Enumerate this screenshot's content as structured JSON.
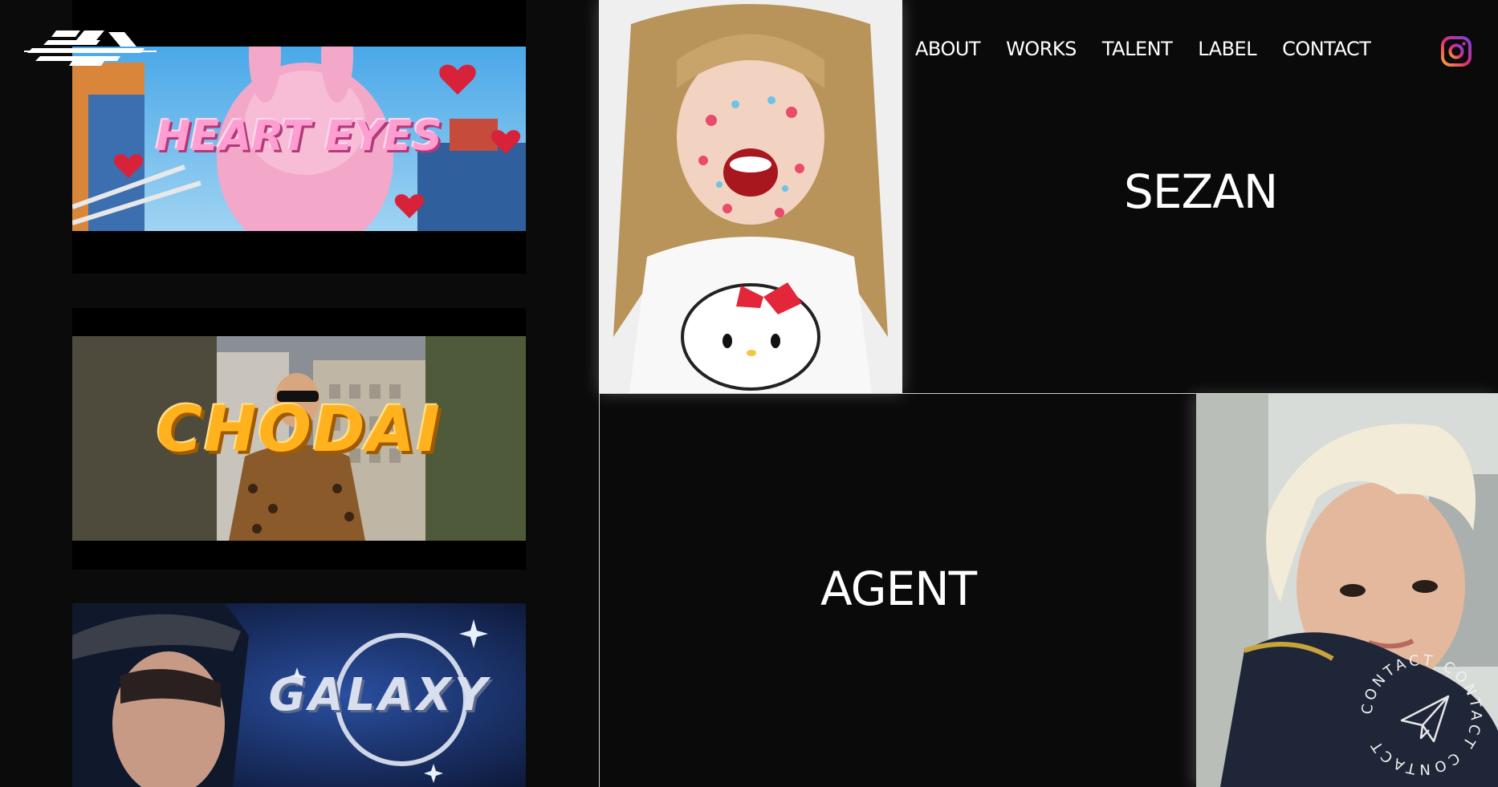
{
  "brand": {
    "logo_icon": "brand-logo-icon"
  },
  "nav": {
    "items": [
      {
        "label": "ABOUT"
      },
      {
        "label": "WORKS"
      },
      {
        "label": "TALENT"
      },
      {
        "label": "LABEL"
      },
      {
        "label": "CONTACT"
      }
    ],
    "instagram_icon": "instagram-icon"
  },
  "works": [
    {
      "title": "HEART EYES"
    },
    {
      "title": "CHODAI"
    },
    {
      "title": "GALAXY"
    }
  ],
  "talents": [
    {
      "name": "SEZAN"
    },
    {
      "name": "AGENT"
    }
  ],
  "contact_badge": {
    "ring_text": "CONTACT CONTACT CONTACT",
    "icon": "paper-plane-icon"
  },
  "colors": {
    "background": "#0a0a0a",
    "text": "#ffffff",
    "divider": "#cfcfcf"
  }
}
